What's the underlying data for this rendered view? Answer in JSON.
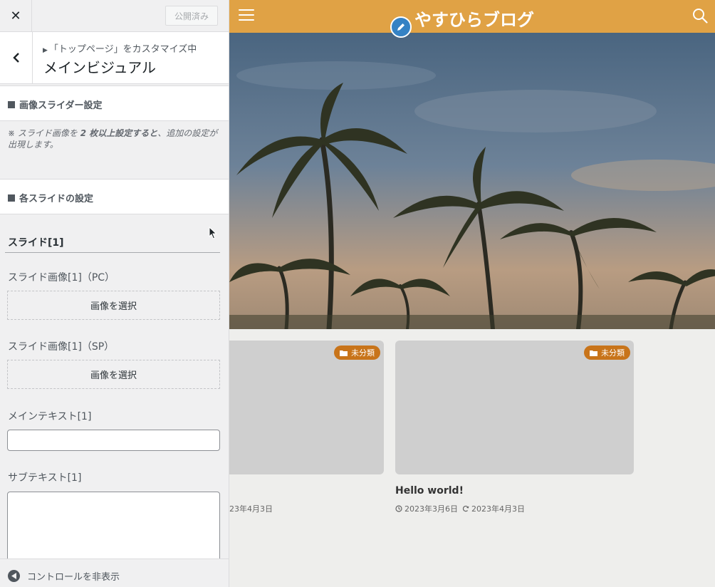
{
  "topbar": {
    "close_symbol": "✕",
    "publish_label": "公開済み"
  },
  "section": {
    "breadcrumb": "「トップページ」をカスタマイズ中",
    "title": "メインビジュアル"
  },
  "groups": {
    "slider_settings": "画像スライダー設定",
    "note_prefix": "※ スライド画像を ",
    "note_bold": "2 枚以上設定すると",
    "note_suffix": "、追加の設定が出現します。",
    "each_slide": "各スライドの設定"
  },
  "slide": {
    "heading": "スライド[1]",
    "image_pc_label": "スライド画像[1]（PC）",
    "image_sp_label": "スライド画像[1]（SP）",
    "select_image_label": "画像を選択",
    "main_text_label": "メインテキスト[1]",
    "main_text_value": "",
    "sub_text_label": "サブテキスト[1]",
    "sub_text_value": ""
  },
  "footer": {
    "hide_controls_label": "コントロールを非表示"
  },
  "preview": {
    "site_title": "やすひらブログ",
    "accent_color": "#e0a245",
    "badge_color": "#c8741a",
    "cards": [
      {
        "category": "未分類",
        "title": "",
        "updated": "23年4月3日"
      },
      {
        "category": "未分類",
        "title": "Hello world!",
        "published": "2023年3月6日",
        "updated": "2023年4月3日"
      }
    ]
  }
}
